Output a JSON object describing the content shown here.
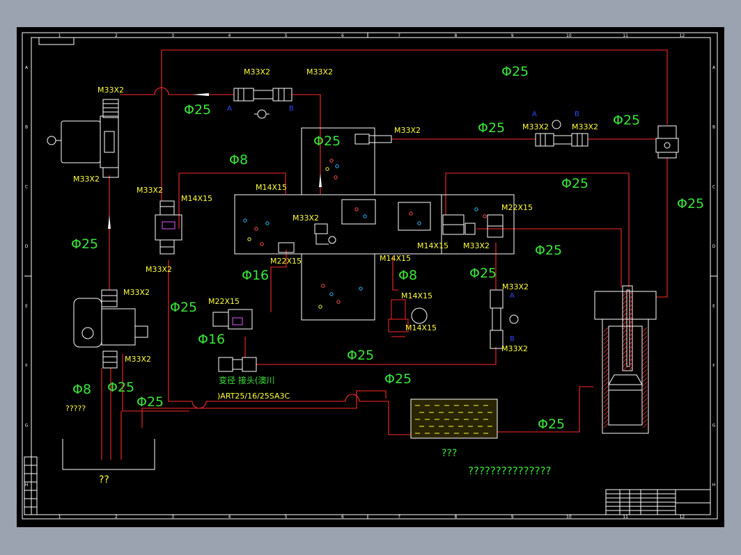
{
  "colors": {
    "background": "#000000",
    "frame": "#ffffff",
    "pipe": "#ff2a2a",
    "dimension": "#39e639",
    "thread": "#ffff3a",
    "port": "#2b4cff",
    "hatch": "#ff3030"
  },
  "thread_labels": [
    "M33X2",
    "M33X2",
    "M33X2",
    "M33X2",
    "M33X2",
    "M33X2",
    "M33X2",
    "M33X2",
    "M14X15",
    "M14X15",
    "M22X15",
    "M33X2",
    "M33X2",
    "M14X15",
    "M33X2",
    "M33X2",
    "M22X15",
    "M22X15",
    "M14X15",
    "M14X15",
    "M33X2",
    "M33X2",
    "M33X2",
    "M14X15",
    "M33X2",
    "M33X2"
  ],
  "dimension_labels": [
    "Φ25",
    "Φ25",
    "Φ25",
    "Φ25",
    "Φ25",
    "Φ8",
    "Φ25",
    "Φ25",
    "Φ25",
    "Φ25",
    "Φ16",
    "Φ25",
    "Φ8",
    "Φ25",
    "Φ16",
    "Φ25",
    "Φ8",
    "Φ25",
    "Φ25",
    "Φ25",
    "Φ25"
  ],
  "port_labels": [
    "A",
    "B",
    "A",
    "B",
    "A",
    "B"
  ],
  "adapter_label": "变径 接头(澳川",
  "adapter_code": ")ART25/16/25SA3C",
  "unknown_labels": [
    "?????",
    "??",
    "???",
    "???????????????"
  ],
  "border_cols": [
    "1",
    "2",
    "3",
    "4",
    "5",
    "6",
    "7",
    "8",
    "9",
    "10",
    "11",
    "12"
  ],
  "border_rows": [
    "A",
    "B",
    "C",
    "D",
    "E",
    "F",
    "G",
    "H"
  ]
}
